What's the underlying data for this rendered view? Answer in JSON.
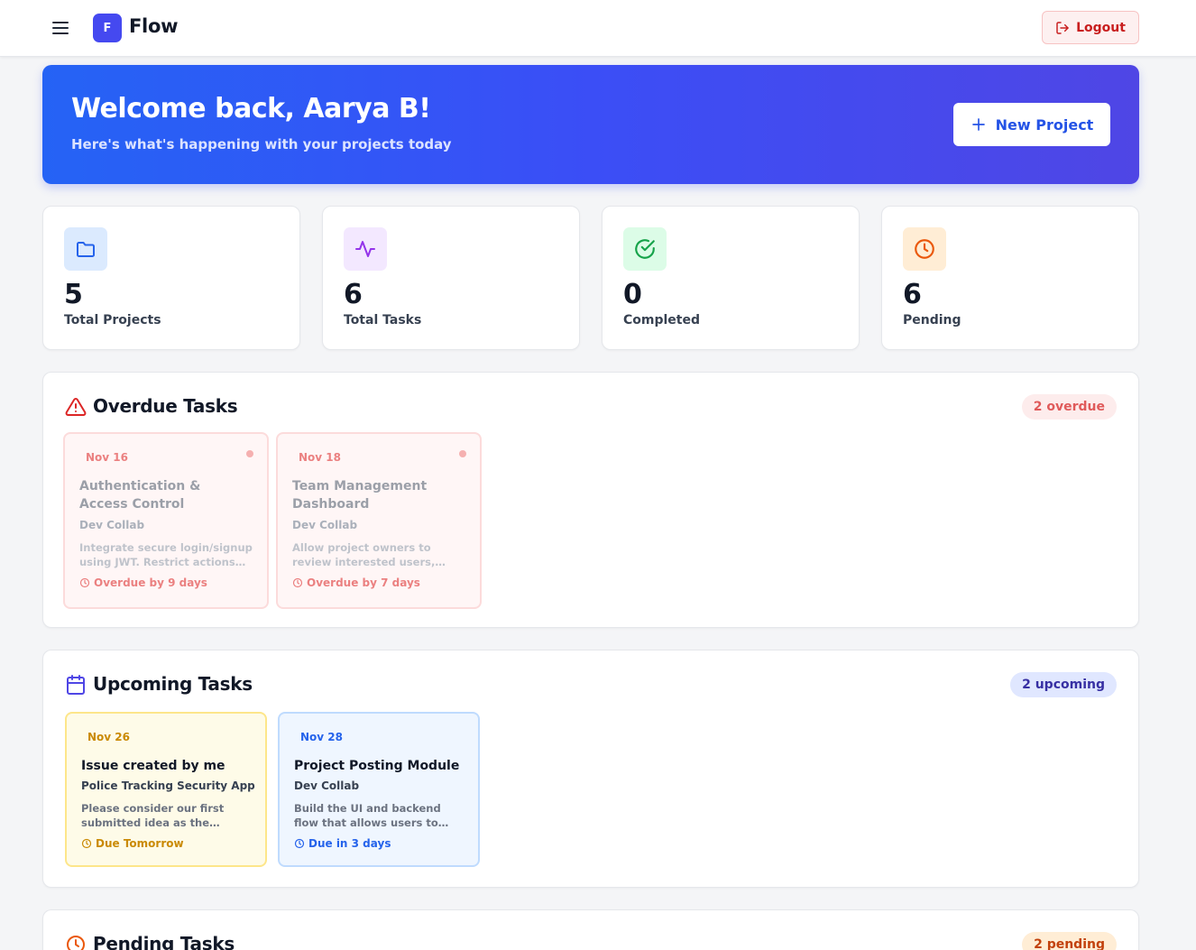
{
  "app": {
    "logo_letter": "F",
    "name": "Flow"
  },
  "header": {
    "logout_label": "Logout"
  },
  "hero": {
    "title": "Welcome back, Aarya B!",
    "subtitle": "Here's what's happening with your projects today",
    "new_project_label": "New Project"
  },
  "stats": [
    {
      "value": "5",
      "label": "Total Projects",
      "icon": "folder-icon",
      "color": "#2563eb",
      "bg": "#dbeafe"
    },
    {
      "value": "6",
      "label": "Total Tasks",
      "icon": "activity-icon",
      "color": "#9333ea",
      "bg": "#f3e8ff"
    },
    {
      "value": "0",
      "label": "Completed",
      "icon": "check-circle-icon",
      "color": "#16a34a",
      "bg": "#dcfce7"
    },
    {
      "value": "6",
      "label": "Pending",
      "icon": "clock-icon",
      "color": "#ea580c",
      "bg": "#ffedd5"
    }
  ],
  "overdue": {
    "title": "Overdue Tasks",
    "badge": "2 overdue",
    "tasks": [
      {
        "date": "Nov 16",
        "title": "Authentication & Access Control",
        "project": "Dev Collab",
        "description": "Integrate secure login/signup using JWT. Restrict actions lik...",
        "due": "Overdue by 9 days"
      },
      {
        "date": "Nov 18",
        "title": "Team Management Dashboard",
        "project": "Dev Collab",
        "description": "Allow project owners to review interested users, accept or...",
        "due": "Overdue by 7 days"
      }
    ]
  },
  "upcoming": {
    "title": "Upcoming Tasks",
    "badge": "2 upcoming",
    "tasks": [
      {
        "date": "Nov 26",
        "title": "Issue created by me",
        "project": "Police Tracking Security App",
        "description": "Please consider our first submitted idea as the official...",
        "due": "Due Tomorrow"
      },
      {
        "date": "Nov 28",
        "title": "Project Posting Module",
        "project": "Dev Collab",
        "description": "Build the UI and backend flow that allows users to create a...",
        "due": "Due in 3 days"
      }
    ]
  },
  "pending": {
    "title": "Pending Tasks",
    "badge": "2 pending"
  },
  "colors": {
    "brand": "#4549f0",
    "danger": "#dc2626",
    "upcoming_yellow": "#facc15",
    "upcoming_blue": "#bfdbfe"
  }
}
